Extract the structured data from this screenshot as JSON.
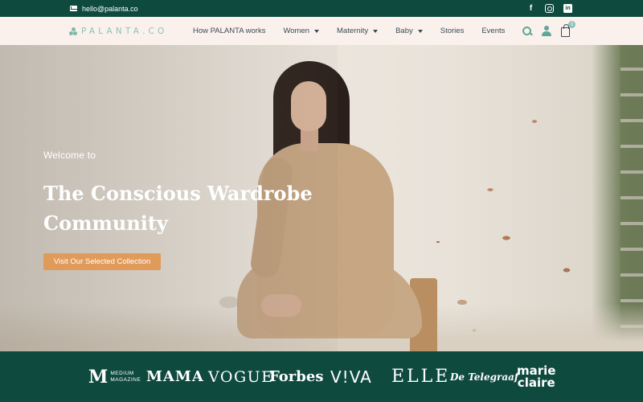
{
  "topbar": {
    "email": "hello@palanta.co",
    "social_icons": [
      "facebook-icon",
      "instagram-icon",
      "linkedin-icon"
    ]
  },
  "nav": {
    "logo_text": "PALANTA.CO",
    "items": [
      {
        "label": "How PALANTA works",
        "has_dropdown": false
      },
      {
        "label": "Women",
        "has_dropdown": true
      },
      {
        "label": "Maternity",
        "has_dropdown": true
      },
      {
        "label": "Baby",
        "has_dropdown": true
      },
      {
        "label": "Stories",
        "has_dropdown": false
      },
      {
        "label": "Events",
        "has_dropdown": false
      }
    ],
    "cart_count": "0",
    "icons": [
      "search-icon",
      "user-icon",
      "shopping-bag-icon"
    ]
  },
  "hero": {
    "welcome": "Welcome to",
    "headline_line1": "The Conscious Wardrobe",
    "headline_line2": "Community",
    "cta_label": "Visit Our Selected Collection"
  },
  "press": {
    "medium_mark": "M",
    "medium_line1": "MEDIUM",
    "medium_line2": "MAGAZINE",
    "mama": "MAMA",
    "vogue": "VOGUE",
    "forbes": "Forbes",
    "viva": "V!VA",
    "elle": "ELLE",
    "telegraaf": "De Telegraaf",
    "marie_line1": "marie",
    "marie_line2": "claire"
  },
  "colors": {
    "brand_green": "#0f4a3f",
    "nav_bg": "#fbf1ec",
    "accent_orange": "#e09b5a",
    "logo_mint": "#8cc2b8"
  }
}
